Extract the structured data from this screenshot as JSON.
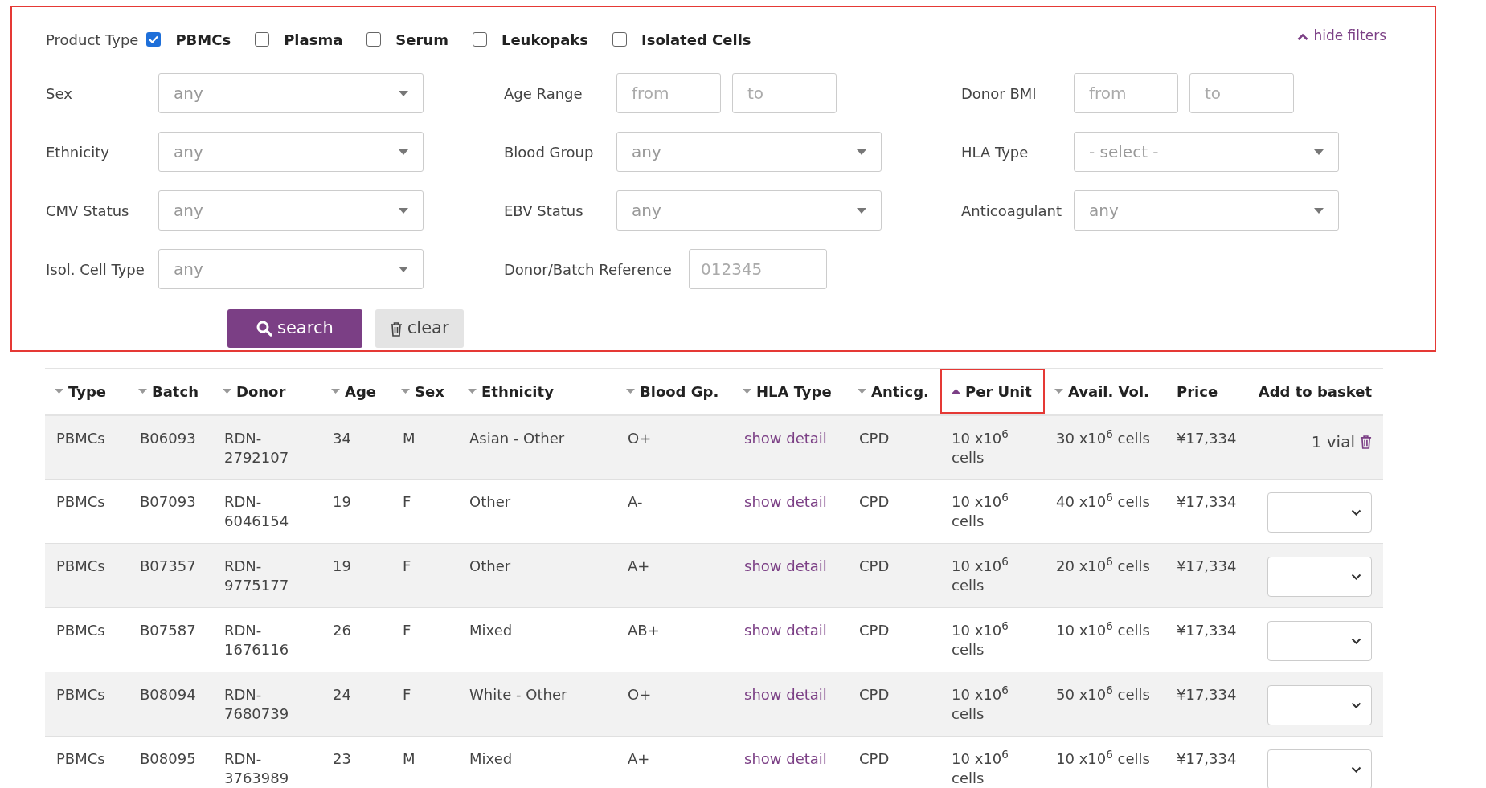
{
  "filters": {
    "product_type": {
      "label": "Product Type",
      "options": [
        {
          "label": "PBMCs",
          "checked": true
        },
        {
          "label": "Plasma",
          "checked": false
        },
        {
          "label": "Serum",
          "checked": false
        },
        {
          "label": "Leukopaks",
          "checked": false
        },
        {
          "label": "Isolated Cells",
          "checked": false
        }
      ]
    },
    "hide_link": "hide filters",
    "columns": [
      [
        {
          "label": "Sex",
          "kind": "select",
          "value": "any"
        },
        {
          "label": "Ethnicity",
          "kind": "select",
          "value": "any"
        },
        {
          "label": "CMV Status",
          "kind": "select",
          "value": "any"
        },
        {
          "label": "Isol. Cell Type",
          "kind": "select",
          "value": "any"
        }
      ],
      [
        {
          "label": "Age Range",
          "kind": "range",
          "from": {
            "placeholder": "from"
          },
          "to": {
            "placeholder": "to"
          }
        },
        {
          "label": "Blood Group",
          "kind": "select",
          "value": "any"
        },
        {
          "label": "EBV Status",
          "kind": "select",
          "value": "any"
        },
        {
          "label": "Donor/Batch Reference",
          "kind": "text",
          "placeholder": "012345"
        }
      ],
      [
        {
          "label": "Donor BMI",
          "kind": "range",
          "from": {
            "placeholder": "from"
          },
          "to": {
            "placeholder": "to"
          }
        },
        {
          "label": "HLA Type",
          "kind": "select",
          "value": "- select -"
        },
        {
          "label": "Anticoagulant",
          "kind": "select",
          "value": "any"
        }
      ]
    ],
    "search_button": "search",
    "clear_button": "clear"
  },
  "table": {
    "columns": [
      {
        "label": "Type",
        "sortable": true,
        "sorted": false,
        "highlighted": false
      },
      {
        "label": "Batch",
        "sortable": true,
        "sorted": false,
        "highlighted": false
      },
      {
        "label": "Donor",
        "sortable": true,
        "sorted": false,
        "highlighted": false
      },
      {
        "label": "Age",
        "sortable": true,
        "sorted": false,
        "highlighted": false
      },
      {
        "label": "Sex",
        "sortable": true,
        "sorted": false,
        "highlighted": false
      },
      {
        "label": "Ethnicity",
        "sortable": true,
        "sorted": false,
        "highlighted": false
      },
      {
        "label": "Blood Gp.",
        "sortable": true,
        "sorted": false,
        "highlighted": false
      },
      {
        "label": "HLA Type",
        "sortable": true,
        "sorted": false,
        "highlighted": false
      },
      {
        "label": "Anticg.",
        "sortable": true,
        "sorted": false,
        "highlighted": false
      },
      {
        "label": "Per Unit",
        "sortable": true,
        "sorted": true,
        "highlighted": true
      },
      {
        "label": "Avail. Vol.",
        "sortable": true,
        "sorted": false,
        "highlighted": false
      },
      {
        "label": "Price",
        "sortable": false,
        "highlighted": false
      },
      {
        "label": "Add to basket",
        "sortable": false,
        "highlighted": false
      }
    ],
    "rows": [
      {
        "type": "PBMCs",
        "batch": "B06093",
        "donor": "RDN-2792107",
        "age": "34",
        "sex": "M",
        "ethnicity": "Asian - Other",
        "blood": "O+",
        "hla": "show detail",
        "anticoagulant": "CPD",
        "per_unit": "10 x10$^{6}$ cells",
        "avail": "30 x10$^{6}$ cells",
        "price": "¥17,334",
        "basket": {
          "kind": "vial",
          "text": "1 vial"
        }
      },
      {
        "type": "PBMCs",
        "batch": "B07093",
        "donor": "RDN-6046154",
        "age": "19",
        "sex": "F",
        "ethnicity": "Other",
        "blood": "A-",
        "hla": "show detail",
        "anticoagulant": "CPD",
        "per_unit": "10 x10$^{6}$ cells",
        "avail": "40 x10$^{6}$ cells",
        "price": "¥17,334",
        "basket": {
          "kind": "select"
        }
      },
      {
        "type": "PBMCs",
        "batch": "B07357",
        "donor": "RDN-9775177",
        "age": "19",
        "sex": "F",
        "ethnicity": "Other",
        "blood": "A+",
        "hla": "show detail",
        "anticoagulant": "CPD",
        "per_unit": "10 x10$^{6}$ cells",
        "avail": "20 x10$^{6}$ cells",
        "price": "¥17,334",
        "basket": {
          "kind": "select"
        }
      },
      {
        "type": "PBMCs",
        "batch": "B07587",
        "donor": "RDN-1676116",
        "age": "26",
        "sex": "F",
        "ethnicity": "Mixed",
        "blood": "AB+",
        "hla": "show detail",
        "anticoagulant": "CPD",
        "per_unit": "10 x10$^{6}$ cells",
        "avail": "10 x10$^{6}$ cells",
        "price": "¥17,334",
        "basket": {
          "kind": "select"
        }
      },
      {
        "type": "PBMCs",
        "batch": "B08094",
        "donor": "RDN-7680739",
        "age": "24",
        "sex": "F",
        "ethnicity": "White - Other",
        "blood": "O+",
        "hla": "show detail",
        "anticoagulant": "CPD",
        "per_unit": "10 x10$^{6}$ cells",
        "avail": "50 x10$^{6}$ cells",
        "price": "¥17,334",
        "basket": {
          "kind": "select"
        }
      },
      {
        "type": "PBMCs",
        "batch": "B08095",
        "donor": "RDN-3763989",
        "age": "23",
        "sex": "M",
        "ethnicity": "Mixed",
        "blood": "A+",
        "hla": "show detail",
        "anticoagulant": "CPD",
        "per_unit": "10 x10$^{6}$ cells",
        "avail": "10 x10$^{6}$ cells",
        "price": "¥17,334",
        "basket": {
          "kind": "select"
        }
      }
    ]
  }
}
